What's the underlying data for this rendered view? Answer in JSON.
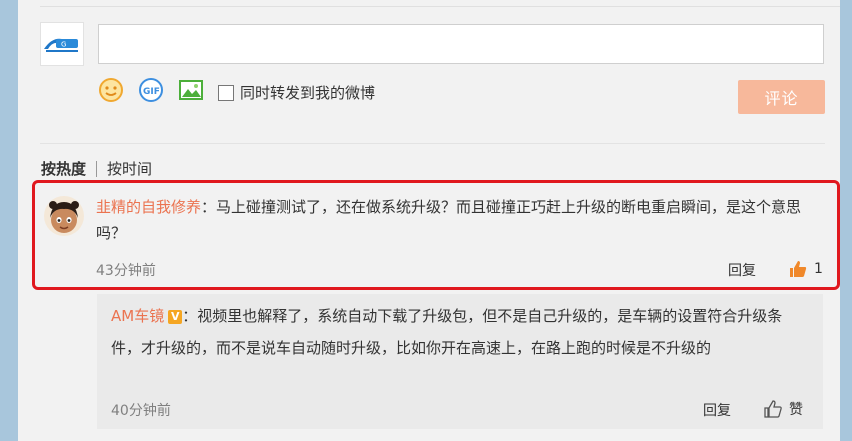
{
  "composer": {
    "input_placeholder": "",
    "forward_label": "同时转发到我的微博",
    "forward_checked": false,
    "submit_label": "评论",
    "icons": [
      "emoji-icon",
      "gif-icon",
      "image-icon"
    ]
  },
  "sort": {
    "tabs": [
      "按热度",
      "按时间"
    ],
    "active": "按热度"
  },
  "comments": [
    {
      "user": "韭精的自我修养",
      "text": "：马上碰撞测试了，还在做系统升级？而且碰撞正巧赶上升级的断电重启瞬间，是这个意思吗？",
      "time": "43分钟前",
      "reply_label": "回复",
      "likes": "1",
      "replies": [
        {
          "user": "AM车镜",
          "badge": "V",
          "text": "：视频里也解释了，系统自动下载了升级包，但不是自己升级的，是车辆的设置符合升级条件，才升级的，而不是说车自动随时升级，比如你开在高速上，在路上跑的时候是不升级的",
          "time": "40分钟前",
          "reply_label": "回复",
          "like_label": "赞"
        }
      ]
    }
  ],
  "colors": {
    "accent": "#eb7350",
    "highlight": "#e0181e",
    "submit_bg": "#f7b89b"
  }
}
